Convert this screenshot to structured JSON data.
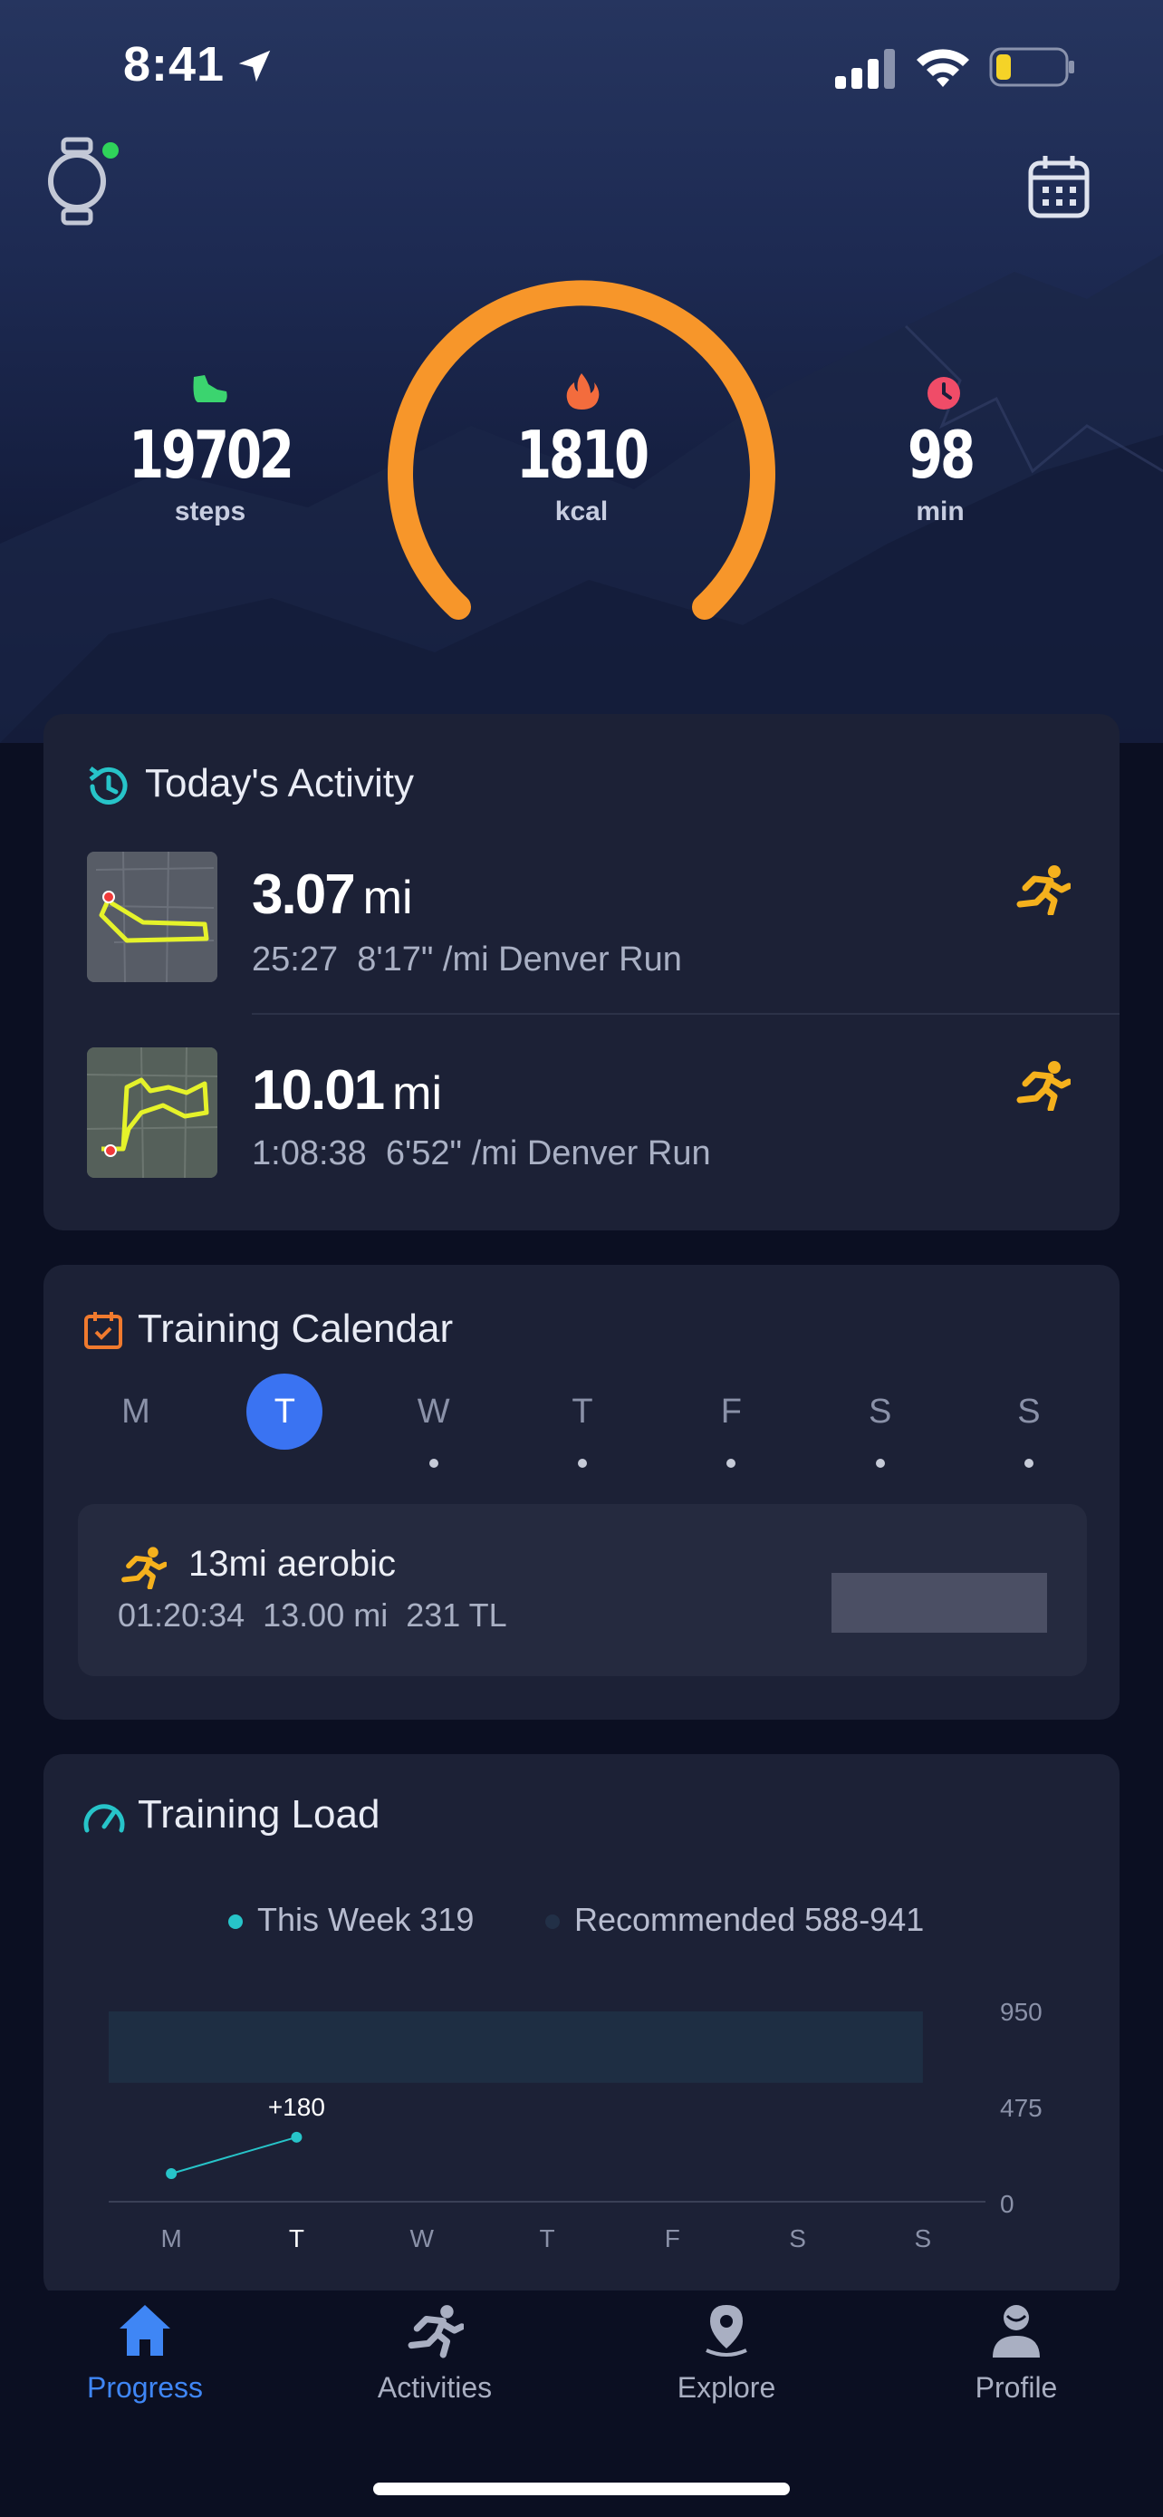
{
  "status_bar": {
    "time": "8:41"
  },
  "colors": {
    "accent_orange": "#f7962a",
    "accent_blue": "#3a73f2",
    "teal": "#27c4c9",
    "runner_yellow": "#f5b11d"
  },
  "summary": {
    "steps": {
      "value": "19702",
      "unit": "steps"
    },
    "kcal": {
      "value": "1810",
      "unit": "kcal"
    },
    "minutes": {
      "value": "98",
      "unit": "min"
    }
  },
  "todays_activity": {
    "title": "Today's Activity",
    "items": [
      {
        "distance": "3.07",
        "distance_unit": "mi",
        "details": "25:27  8'17\" /mi Denver Run",
        "icon": "running-icon"
      },
      {
        "distance": "10.01",
        "distance_unit": "mi",
        "details": "1:08:38  6'52\" /mi Denver Run",
        "icon": "running-icon"
      }
    ]
  },
  "training_calendar": {
    "title": "Training Calendar",
    "days": [
      "M",
      "T",
      "W",
      "T",
      "F",
      "S",
      "S"
    ],
    "selected_index": 1,
    "workout": {
      "name": "13mi aerobic",
      "details": "01:20:34  13.00 mi  231 TL"
    }
  },
  "training_load": {
    "title": "Training Load",
    "legend": {
      "this_week": "This Week 319",
      "recommended": "Recommended 588-941"
    }
  },
  "chart_data": {
    "type": "line",
    "categories": [
      "M",
      "T",
      "W",
      "T",
      "F",
      "S",
      "S"
    ],
    "series": [
      {
        "name": "This Week",
        "values": [
          139,
          319,
          null,
          null,
          null,
          null,
          null
        ]
      }
    ],
    "recommended_band": [
      588,
      941
    ],
    "annotations": [
      {
        "category_index": 1,
        "text": "+180"
      }
    ],
    "y_ticks": [
      "950",
      "475",
      "0"
    ],
    "ylim": [
      0,
      950
    ],
    "title": "",
    "xlabel": "",
    "ylabel": ""
  },
  "tabs": [
    {
      "label": "Progress",
      "icon": "home-icon",
      "active": true
    },
    {
      "label": "Activities",
      "icon": "running-icon",
      "active": false
    },
    {
      "label": "Explore",
      "icon": "map-pin-icon",
      "active": false
    },
    {
      "label": "Profile",
      "icon": "person-icon",
      "active": false
    }
  ]
}
